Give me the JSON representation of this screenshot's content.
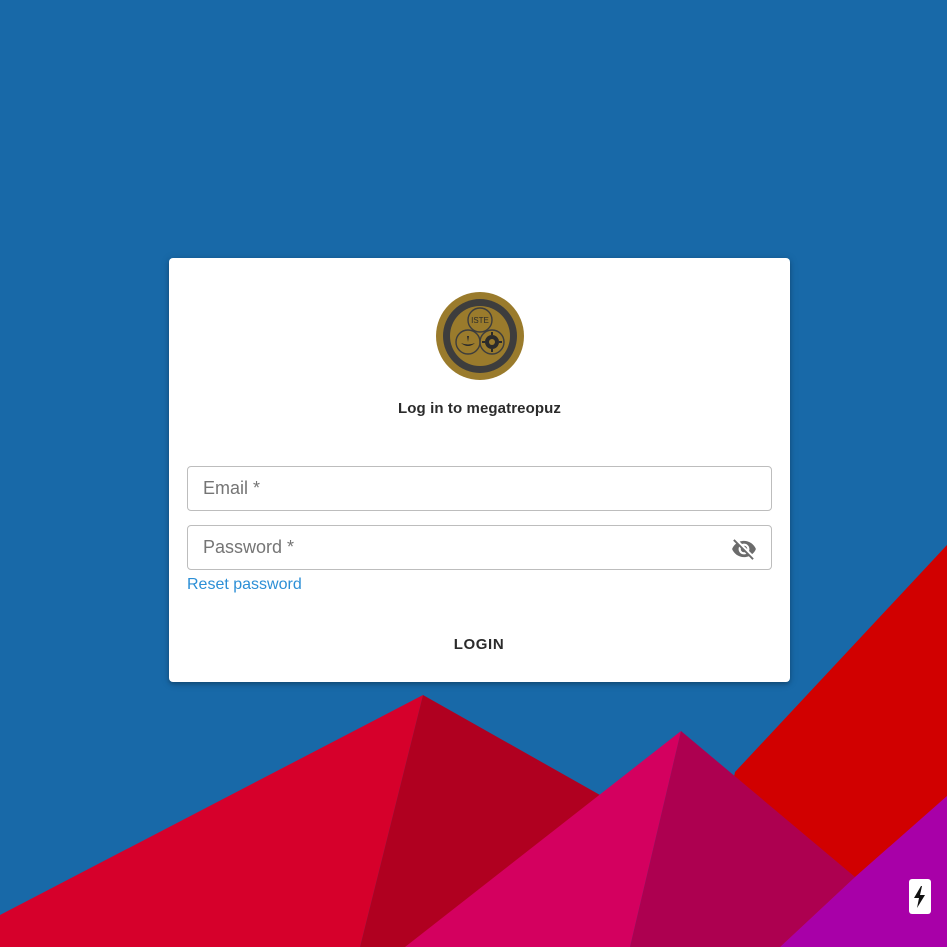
{
  "login": {
    "logo_text": "ISTE",
    "logo_ring_text": "INDIAN SOCIETY FOR TECHNICAL EDUCATION",
    "title": "Log in to megatreopuz",
    "email_placeholder": "Email *",
    "password_placeholder": "Password *",
    "reset_password": "Reset password",
    "login_button": "LOGIN"
  },
  "icons": {
    "password_toggle": "eye-off-icon",
    "corner_badge": "lightning-bolt-icon"
  },
  "colors": {
    "background": "#1869a8",
    "link": "#2c8fd6",
    "logo_gold": "#9a7b2c",
    "mountain_red": "#d6002b",
    "mountain_pink": "#d4005f",
    "mountain_purple": "#a800a8"
  }
}
